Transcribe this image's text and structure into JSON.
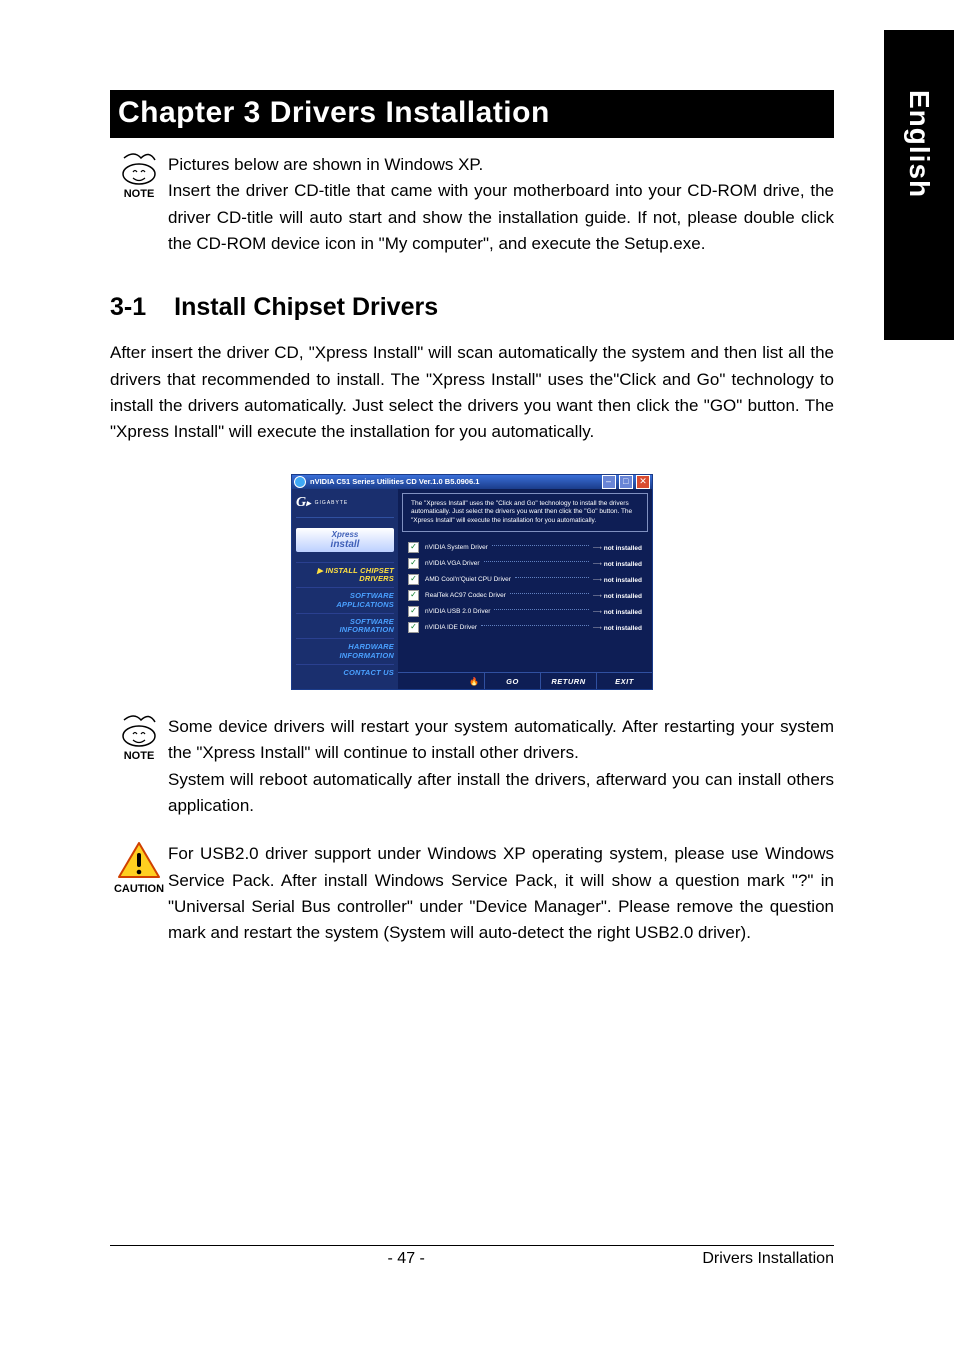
{
  "side_tab": "English",
  "chapter_title": "Chapter 3 Drivers Installation",
  "note_label": "NOTE",
  "caution_label": "CAUTION",
  "intro_note": "Pictures below are shown in Windows XP.\nInsert the driver CD-title that came with your motherboard into your CD-ROM drive, the driver CD-title will auto start and show the installation guide. If not, please double click the CD-ROM device icon in \"My computer\", and execute the Setup.exe.",
  "section": {
    "number": "3-1",
    "title": "Install Chipset Drivers"
  },
  "section_body": "After insert the driver CD, \"Xpress Install\" will  scan automatically the system and then list all the drivers that recommended to install. The \"Xpress Install\" uses the\"Click and Go\" technology to install the drivers automatically. Just select the drivers you want then click the \"GO\" button. The \"Xpress Install\" will execute the installation for you automatically.",
  "note2": "Some device drivers will restart your system automatically. After restarting your system the \"Xpress Install\" will continue to install other drivers.\nSystem will reboot automatically after install the drivers, afterward you can install others application.",
  "caution": "For USB2.0 driver support under Windows XP operating system, please use Windows Service Pack. After install Windows Service Pack, it will show a question mark \"?\" in \"Universal Serial Bus controller\" under \"Device Manager\". Please remove the question mark and restart the system (System will auto-detect the right USB2.0 driver).",
  "footer": {
    "page": "- 47 -",
    "section": "Drivers Installation"
  },
  "app": {
    "title": "nVIDIA C51 Series Utilities CD Ver.1.0 B5.0906.1",
    "logo_text": "GIGABYTE",
    "xpress_l1": "Xpress",
    "xpress_l2": "install",
    "menu": {
      "install": "INSTALL CHIPSET DRIVERS",
      "sw_apps": "SOFTWARE APPLICATIONS",
      "sw_info": "SOFTWARE INFORMATION",
      "hw_info": "HARDWARE INFORMATION",
      "contact": "CONTACT US"
    },
    "desc": "The \"Xpress Install\" uses the \"Click and Go\" technology to install the drivers automatically. Just select the drivers you want then click the \"Go\" button. The \"Xpress Install\" will execute the installation for you automatically.",
    "drivers": [
      {
        "name": "nVIDIA System Driver",
        "status": "not installed"
      },
      {
        "name": "nVIDIA VGA Driver",
        "status": "not installed"
      },
      {
        "name": "AMD Cool'n'Quiet CPU Driver",
        "status": "not installed"
      },
      {
        "name": "RealTek AC97 Codec Driver",
        "status": "not installed"
      },
      {
        "name": "nVIDIA USB 2.0 Driver",
        "status": "not installed"
      },
      {
        "name": "nVIDIA IDE Driver",
        "status": "not installed"
      }
    ],
    "buttons": {
      "go": "GO",
      "return": "RETURN",
      "exit": "EXIT"
    }
  }
}
